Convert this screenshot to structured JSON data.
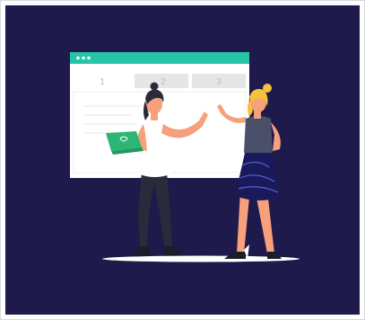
{
  "illustration": {
    "colors": {
      "background": "#1e1a4b",
      "accent": "#27c5a8",
      "browser_body": "#ffffff",
      "tab_inactive": "#e6e6e9",
      "skin": "#f7a07c",
      "hair_dark": "#2a2a3a",
      "hair_blonde": "#f5c23c",
      "laptop": "#2bb673"
    },
    "tabs": [
      {
        "label": "1"
      },
      {
        "label": "2"
      },
      {
        "label": "3"
      }
    ]
  }
}
